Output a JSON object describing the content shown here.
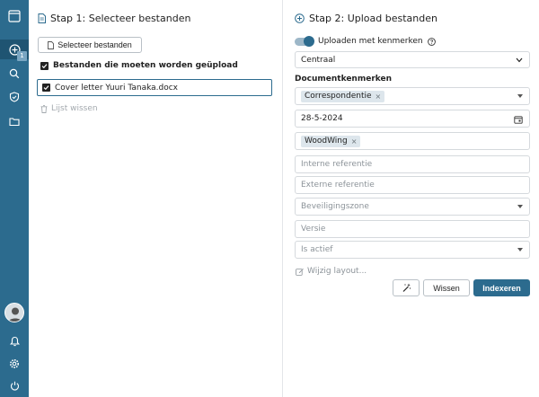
{
  "sidebar": {
    "upload_badge": "1"
  },
  "left": {
    "title": "Stap 1: Selecteer bestanden",
    "select_button": "Selecteer bestanden",
    "files_to_upload_label": "Bestanden die moeten worden geüpload",
    "files": [
      {
        "name": "Cover letter Yuuri Tanaka.docx",
        "checked": true
      }
    ],
    "clear_list": "Lijst wissen"
  },
  "right": {
    "title": "Stap 2: Upload bestanden",
    "upload_with_props_label": "Uploaden met kenmerken",
    "upload_with_props_on": true,
    "location_select": "Centraal",
    "doc_props_label": "Documentkenmerken",
    "category_chip": "Correspondentie",
    "date_value": "28-5-2024",
    "company_chip": "WoodWing",
    "internal_ref_placeholder": "Interne referentie",
    "external_ref_placeholder": "Externe referentie",
    "security_zone_placeholder": "Beveiligingszone",
    "version_placeholder": "Versie",
    "is_active_placeholder": "Is actief",
    "edit_layout": "Wijzig layout...",
    "clear_button": "Wissen",
    "index_button": "Indexeren"
  },
  "colors": {
    "sidebar": "#2c6b8e",
    "accent": "#2c6b8e"
  }
}
